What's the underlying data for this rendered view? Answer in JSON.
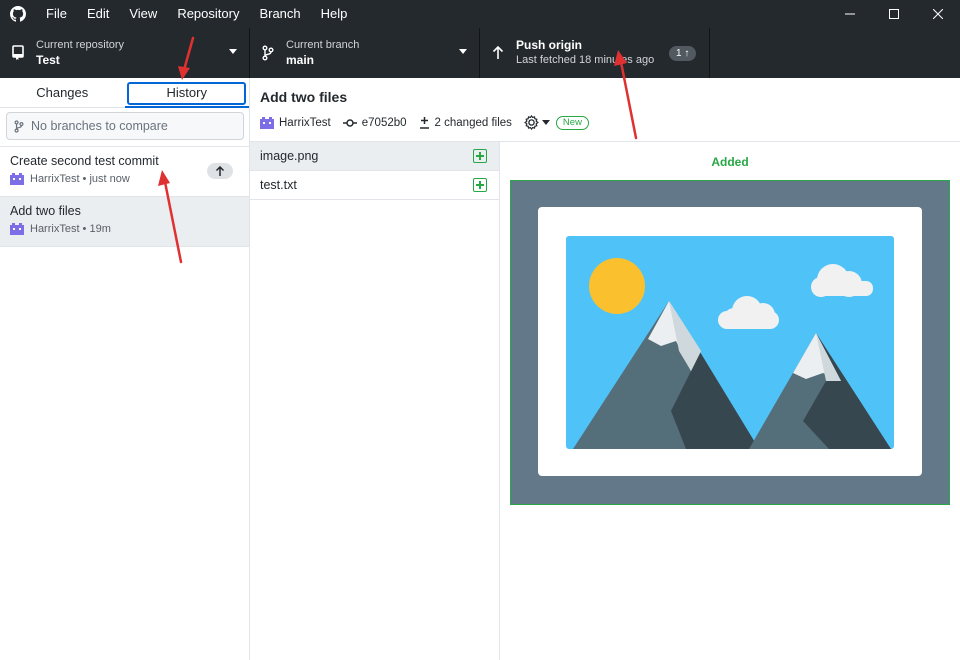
{
  "menu": [
    "File",
    "Edit",
    "View",
    "Repository",
    "Branch",
    "Help"
  ],
  "toolbar": {
    "repo_label": "Current repository",
    "repo_value": "Test",
    "branch_label": "Current branch",
    "branch_value": "main",
    "push_label": "Push origin",
    "push_sub": "Last fetched 18 minutes ago",
    "push_count": "1 ↑"
  },
  "sidebar": {
    "tabs": {
      "changes": "Changes",
      "history": "History"
    },
    "active_tab": "History",
    "compare_placeholder": "No branches to compare",
    "commits": [
      {
        "title": "Create second test commit",
        "meta": "HarrixTest • just now",
        "unpushed": true
      },
      {
        "title": "Add two files",
        "meta": "HarrixTest • 19m",
        "selected": true
      }
    ]
  },
  "commit": {
    "summary": "Add two files",
    "author": "HarrixTest",
    "sha": "e7052b0",
    "changed_files": "2 changed files",
    "new_badge": "New"
  },
  "files": [
    {
      "name": "image.png",
      "status": "added",
      "selected": true
    },
    {
      "name": "test.txt",
      "status": "added"
    }
  ],
  "diff": {
    "label": "Added"
  },
  "colors": {
    "toolbar_bg": "#24292e",
    "accent_blue": "#0366d6",
    "added_green": "#28a745",
    "annotation_red": "#e03131"
  }
}
